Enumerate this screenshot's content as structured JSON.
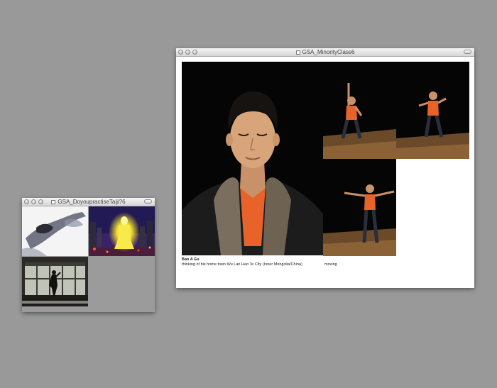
{
  "window_small": {
    "title": "GSA_DoyoupractiseTaiji?6"
  },
  "window_large": {
    "title": "GSA_MinorityClass6",
    "caption": {
      "name": "Bao A Gu",
      "description": "thinking of his home town Wu Lan Hao Te City (Inner Mongolia/China)",
      "secondary": "moving"
    }
  },
  "colors": {
    "desktop": "#999999",
    "photo_bg": "#000000",
    "shirt_orange": "#e8632a"
  }
}
